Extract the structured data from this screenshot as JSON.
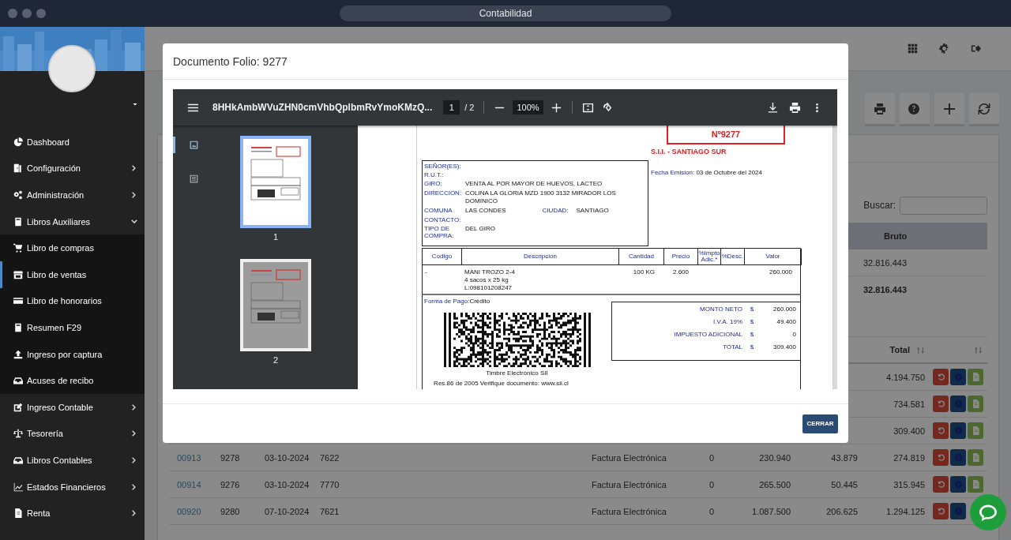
{
  "window": {
    "title": "Contabilidad"
  },
  "sidebar": {
    "items": [
      {
        "label": "Dashboard",
        "kind": "link",
        "selected": false
      },
      {
        "label": "Configuración",
        "kind": "group",
        "expanded": false
      },
      {
        "label": "Administración",
        "kind": "group",
        "expanded": false
      },
      {
        "label": "Libros Auxiliares",
        "kind": "group",
        "expanded": true,
        "children": [
          {
            "label": "Libro de compras",
            "selected": false
          },
          {
            "label": "Libro de ventas",
            "selected": true
          },
          {
            "label": "Libro de honorarios",
            "selected": false
          },
          {
            "label": "Resumen F29",
            "selected": false
          },
          {
            "label": "Ingreso por captura",
            "selected": false
          },
          {
            "label": "Acuses de recibo",
            "selected": false
          }
        ]
      },
      {
        "label": "Ingreso Contable",
        "kind": "group",
        "expanded": false
      },
      {
        "label": "Tesorería",
        "kind": "group",
        "expanded": false
      },
      {
        "label": "Libros Contables",
        "kind": "group",
        "expanded": false
      },
      {
        "label": "Estados Financieros",
        "kind": "group",
        "expanded": false
      },
      {
        "label": "Renta",
        "kind": "group",
        "expanded": false
      }
    ]
  },
  "search": {
    "label": "Buscar:"
  },
  "summary_table": {
    "columns": [
      "Bruto"
    ],
    "rows": [
      {
        "kind": "detail",
        "value": "32.816.443"
      },
      {
        "kind": "total",
        "value": "32.816.443"
      }
    ]
  },
  "table": {
    "total_heading": "Total",
    "rows": [
      {
        "column_10": "4.194.750"
      },
      {
        "column_10": "734.581"
      },
      {
        "column_10": "309.400"
      },
      {
        "column_1": "00913",
        "column_2": "9278",
        "column_3": "03-10-2024",
        "column_4": "7622",
        "column_6": "Factura Electrónica",
        "column_7": "0",
        "column_8": "230.940",
        "column_9": "43.879",
        "column_10": "274.819"
      },
      {
        "column_1": "00914",
        "column_2": "9276",
        "column_3": "03-10-2024",
        "column_4": "7770",
        "column_6": "Factura Electrónica",
        "column_7": "0",
        "column_8": "265.500",
        "column_9": "50.445",
        "column_10": "315.945"
      },
      {
        "column_1": "00920",
        "column_2": "9280",
        "column_3": "07-10-2024",
        "column_4": "7621",
        "column_6": "Factura Electrónica",
        "column_7": "0",
        "column_8": "1.087.500",
        "column_9": "206.625",
        "column_10": "1.294.125"
      }
    ]
  },
  "modal": {
    "title": "Documento Folio: 9277",
    "button": "CERRAR",
    "viewer": {
      "file_name": "8HHkAmbWVuZHN0cmVhbQplbmRvYmoKMzQ...",
      "page": "1",
      "page_total": "/ 2",
      "zoom": "100%",
      "views": [
        {
          "selected": true
        },
        {
          "selected": false
        }
      ],
      "thumbnails": [
        {
          "label": "1",
          "selected": true
        },
        {
          "label": "2",
          "selected": false
        }
      ]
    },
    "document": {
      "folio": "Nº9277",
      "office": "S.I.I. - SANTIAGO SUR",
      "date": {
        "label": "Fecha Emision:",
        "value": "03 de Octubre del 2024"
      },
      "fields": [
        {
          "label": "SEÑOR(ES):"
        },
        {
          "label": "R.U.T.:"
        },
        {
          "label": "GIRO:",
          "value": "VENTA AL POR MAYOR DE HUEVOS, LACTEO"
        },
        {
          "label": "DIRECCION:",
          "value": "COLINA LA GLORIA MZD 1900 3132 MIRADOR LOS DOMINICO"
        },
        {
          "label": "COMUNA",
          "value": "LAS CONDES",
          "extra_label": "CIUDAD:",
          "extra_value": "SANTIAGO"
        },
        {
          "label": "CONTACTO:"
        },
        {
          "label": "TIPO DE COMPRA:",
          "value": "DEL GIRO"
        }
      ],
      "item_columns": [
        "Codigo",
        "Descripcion",
        "Cantidad",
        "Precio",
        "%Impto Adic.*",
        "%Desc.",
        "Valor"
      ],
      "items": [
        {
          "code": "-",
          "description": [
            "MANI TROZO 2-4",
            "4 sacos x 25 kg",
            "L:098101208247"
          ],
          "quantity": "100 KG",
          "price": "2.600",
          "amount": "260.000"
        }
      ],
      "payment": {
        "label": "Forma de Pago:",
        "value": "Crédito"
      },
      "stamp_caption": "Timbre Electrónico SII",
      "stamp_note": "Res.86 de 2005 Verifique documento: www.sii.cl",
      "totals": [
        {
          "label": "MONTO NETO",
          "currency": "$",
          "value": "260.000"
        },
        {
          "label": "I.V.A. 19%",
          "currency": "$",
          "value": "49.400"
        },
        {
          "label": "IMPUESTO ADICIONAL",
          "currency": "$",
          "value": "0"
        },
        {
          "label": "TOTAL",
          "currency": "$",
          "value": "309.400"
        }
      ]
    }
  }
}
